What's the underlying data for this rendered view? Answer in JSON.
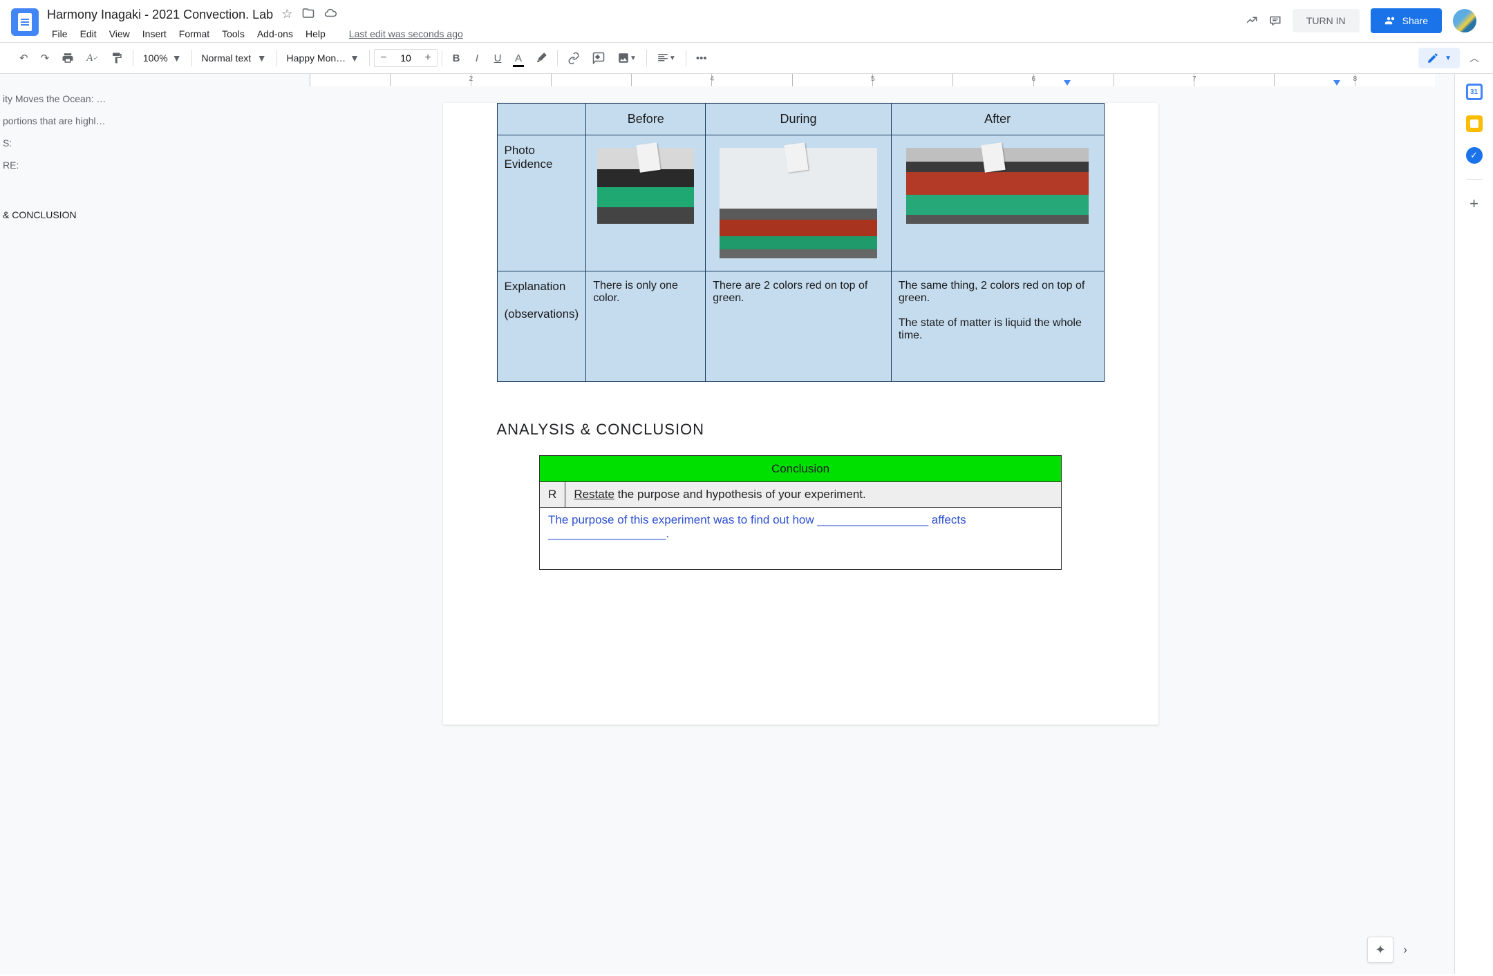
{
  "doc": {
    "title": "Harmony Inagaki - 2021 Convection. Lab",
    "last_edit": "Last edit was seconds ago"
  },
  "menu": {
    "file": "File",
    "edit": "Edit",
    "view": "View",
    "insert": "Insert",
    "format": "Format",
    "tools": "Tools",
    "addons": "Add-ons",
    "help": "Help"
  },
  "header_buttons": {
    "turn_in": "TURN IN",
    "share": "Share"
  },
  "toolbar": {
    "zoom": "100%",
    "style": "Normal text",
    "font": "Happy Mon…",
    "font_size": "10"
  },
  "outline": {
    "items": [
      "ity Moves the Ocean: …",
      "portions that are highl…",
      "S:",
      "RE:",
      "& CONCLUSION"
    ]
  },
  "data_table": {
    "headers": {
      "blank": "",
      "before": "Before",
      "during": "During",
      "after": "After"
    },
    "row1_label": "Photo Evidence",
    "row2_label_a": "Explanation",
    "row2_label_b": "(observations)",
    "expl_before": "There is only one color.",
    "expl_during": "There are 2 colors red on top of green.",
    "expl_after_a": "The same thing, 2 colors red on top of green.",
    "expl_after_b": "The state of matter is liquid the whole time."
  },
  "section_heading": "ANALYSIS & CONCLUSION",
  "conclusion": {
    "header": "Conclusion",
    "r": "R",
    "restate_u": "Restate",
    "restate_rest": " the purpose and hypothesis of your experiment.",
    "body": "The purpose of this experiment was to find out how _________________ affects __________________."
  },
  "ruler_marks": [
    "",
    "",
    "2",
    "",
    "",
    "4",
    "",
    "5",
    "",
    "6",
    "",
    "7",
    "",
    "8"
  ]
}
